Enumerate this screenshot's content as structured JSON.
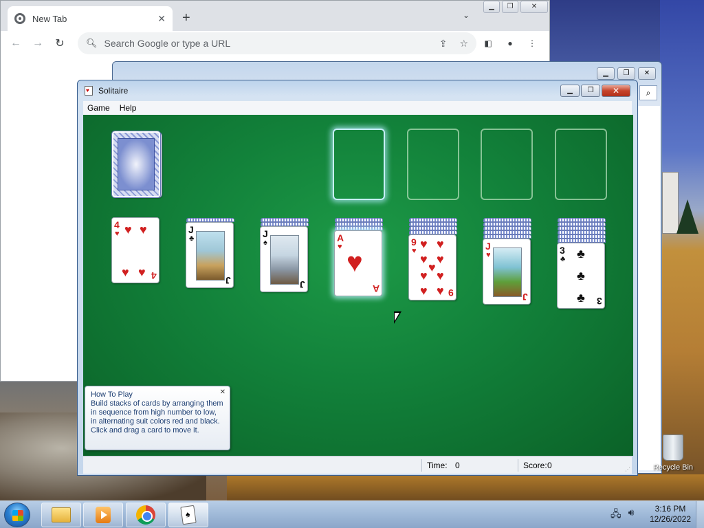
{
  "chrome": {
    "tab_title": "New Tab",
    "omnibox_placeholder": "Search Google or type a URL"
  },
  "solitaire": {
    "title": "Solitaire",
    "menu": [
      "Game",
      "Help"
    ],
    "status": {
      "time_label": "Time:",
      "time_value": "0",
      "score_label": "Score:",
      "score_value": "0"
    },
    "tip": {
      "title": "How To Play",
      "body": "Build stacks of cards by arranging them in sequence from high number to low, in alternating suit colors red and black. Click and drag a card to move it."
    },
    "tableau": [
      {
        "rank": "4",
        "suit": "♥",
        "color": "red"
      },
      {
        "rank": "J",
        "suit": "♣",
        "color": "black"
      },
      {
        "rank": "J",
        "suit": "♠",
        "color": "black"
      },
      {
        "rank": "A",
        "suit": "♥",
        "color": "red"
      },
      {
        "rank": "9",
        "suit": "♥",
        "color": "red"
      },
      {
        "rank": "J",
        "suit": "♥",
        "color": "red"
      },
      {
        "rank": "3",
        "suit": "♣",
        "color": "black"
      }
    ]
  },
  "desktop": {
    "recycle_bin_label": "Recycle Bin"
  },
  "taskbar": {
    "clock_time": "3:16 PM",
    "clock_date": "12/26/2022"
  },
  "icons": {
    "suit_heart": "♥",
    "suit_club": "♣",
    "suit_spade": "♠"
  }
}
